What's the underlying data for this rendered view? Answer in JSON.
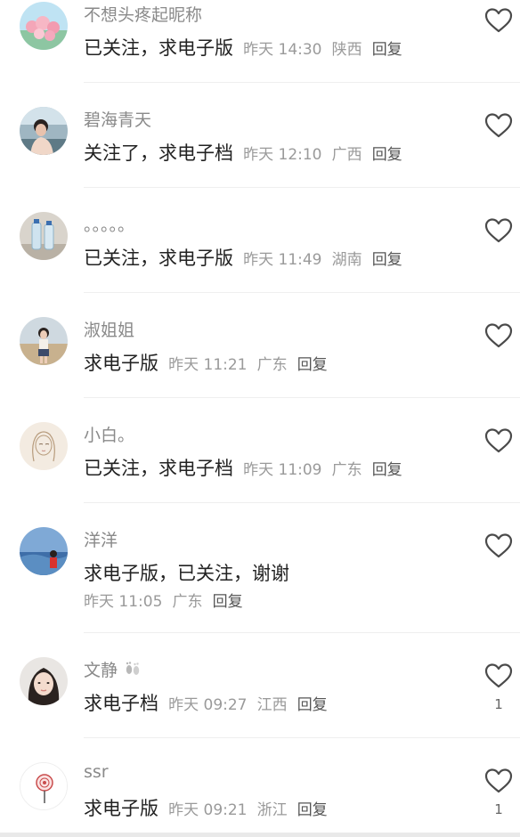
{
  "comments": [
    {
      "nickname": "不想头疼起昵称",
      "text": "已关注，求电子版",
      "time": "昨天 14:30",
      "location": "陕西",
      "reply_label": "回复",
      "likes": ""
    },
    {
      "nickname": "碧海青天",
      "text": "关注了，求电子档",
      "time": "昨天 12:10",
      "location": "广西",
      "reply_label": "回复",
      "likes": ""
    },
    {
      "nickname": "。。。。。",
      "text": "已关注，求电子版",
      "time": "昨天 11:49",
      "location": "湖南",
      "reply_label": "回复",
      "likes": ""
    },
    {
      "nickname": "淑姐姐",
      "text": "求电子版",
      "time": "昨天 11:21",
      "location": "广东",
      "reply_label": "回复",
      "likes": ""
    },
    {
      "nickname": "小白。",
      "text": "已关注，求电子档",
      "time": "昨天 11:09",
      "location": "广东",
      "reply_label": "回复",
      "likes": ""
    },
    {
      "nickname": "洋洋",
      "text": "求电子版，已关注，谢谢",
      "time": "昨天 11:05",
      "location": "广东",
      "reply_label": "回复",
      "likes": ""
    },
    {
      "nickname": "文静",
      "text": "求电子档",
      "time": "昨天 09:27",
      "location": "江西",
      "reply_label": "回复",
      "likes": "1"
    },
    {
      "nickname": "ssr",
      "text": "求电子版",
      "time": "昨天 09:21",
      "location": "浙江",
      "reply_label": "回复",
      "likes": "1"
    }
  ],
  "icons": {
    "like": "heart-outline-icon",
    "nickname_badge": "footprints-icon"
  },
  "colors": {
    "nickname": "#8a8a8a",
    "text": "#222222",
    "meta": "#9a9a9a",
    "reply": "#555555",
    "heart": "#4a4a4a"
  }
}
